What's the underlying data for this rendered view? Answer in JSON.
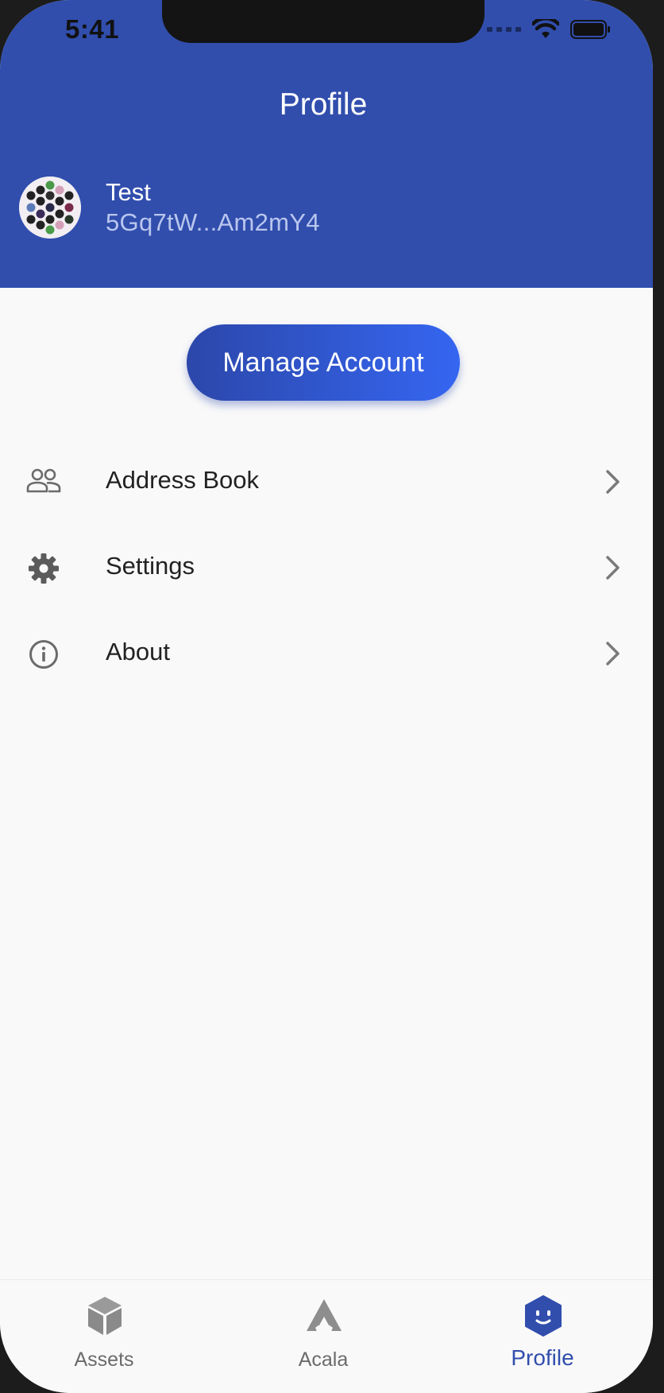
{
  "status_bar": {
    "time": "5:41"
  },
  "header": {
    "title": "Profile"
  },
  "account": {
    "name": "Test",
    "address": "5Gq7tW...Am2mY4"
  },
  "manage_button": {
    "label": "Manage Account"
  },
  "menu": [
    {
      "label": "Address Book",
      "icon": "people-icon"
    },
    {
      "label": "Settings",
      "icon": "gear-icon"
    },
    {
      "label": "About",
      "icon": "info-icon"
    }
  ],
  "bottom_nav": [
    {
      "label": "Assets",
      "icon": "cube-icon",
      "active": false
    },
    {
      "label": "Acala",
      "icon": "acala-logo-icon",
      "active": false
    },
    {
      "label": "Profile",
      "icon": "profile-face-icon",
      "active": true
    }
  ],
  "colors": {
    "primary": "#314ead",
    "accent_gradient_end": "#3566f1",
    "inactive": "#6b6b6b"
  }
}
